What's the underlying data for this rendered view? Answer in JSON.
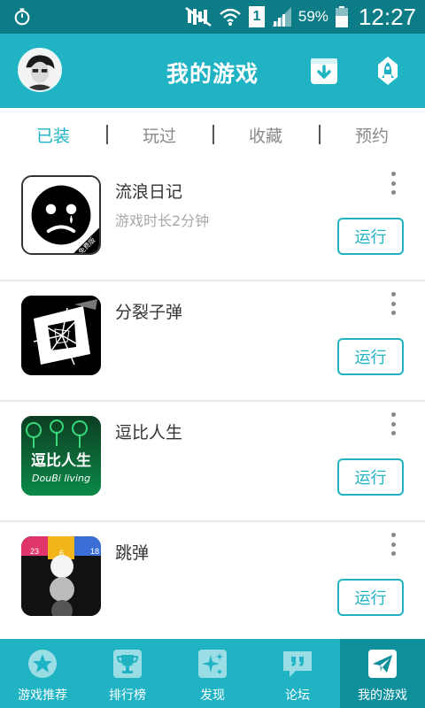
{
  "status_bar": {
    "battery_percent": "59%",
    "sim_slot": "1",
    "time": "12:27"
  },
  "header": {
    "title": "我的游戏"
  },
  "tabs": [
    {
      "label": "已装",
      "active": true
    },
    {
      "label": "玩过",
      "active": false
    },
    {
      "label": "收藏",
      "active": false
    },
    {
      "label": "预约",
      "active": false
    }
  ],
  "games": [
    {
      "name": "流浪日记",
      "play_time": "游戏时长2分钟",
      "action": "运行",
      "icon_badge": "免费版"
    },
    {
      "name": "分裂子弹",
      "play_time": "",
      "action": "运行"
    },
    {
      "name": "逗比人生",
      "play_time": "",
      "action": "运行",
      "icon_text_cn": "逗比人生",
      "icon_text_en": "DouBi living"
    },
    {
      "name": "跳弹",
      "play_time": "",
      "action": "运行",
      "icon_numbers": [
        "23",
        "6",
        "18"
      ]
    }
  ],
  "bottom_nav": [
    {
      "label": "游戏推荐",
      "icon": "star-icon",
      "active": false
    },
    {
      "label": "排行榜",
      "icon": "trophy-icon",
      "active": false
    },
    {
      "label": "发现",
      "icon": "sparkle-icon",
      "active": false
    },
    {
      "label": "论坛",
      "icon": "quote-chat-icon",
      "active": false
    },
    {
      "label": "我的游戏",
      "icon": "paper-plane-icon",
      "active": true
    }
  ],
  "colors": {
    "accent": "#1fb3c4",
    "status_bar": "#0c7d86",
    "active_nav": "#0e8f9c"
  }
}
